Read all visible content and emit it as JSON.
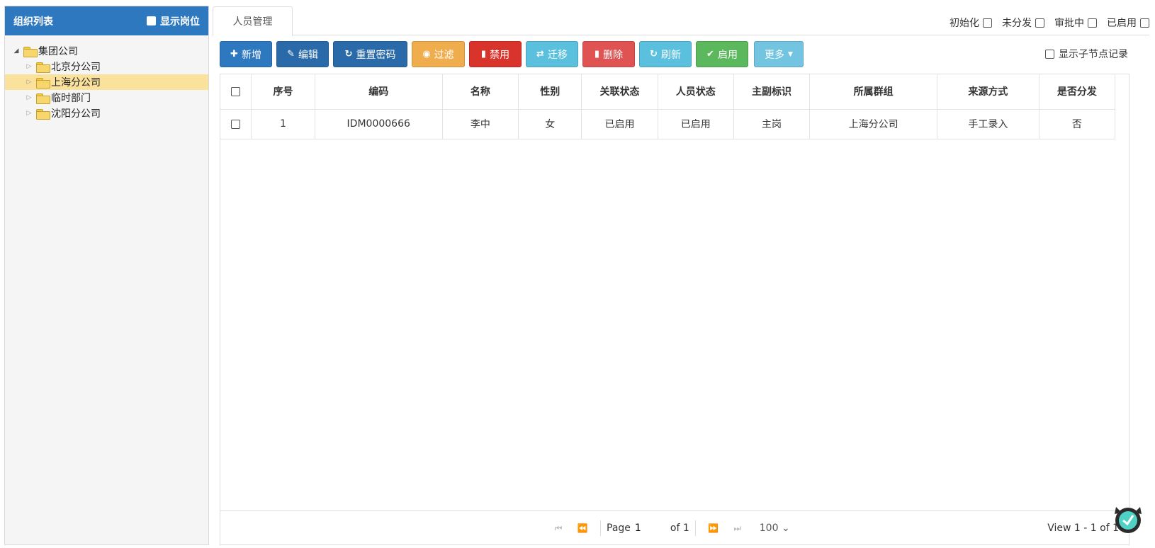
{
  "left": {
    "title": "组织列表",
    "show_post_label": "显示岗位",
    "tree": [
      {
        "label": "集团公司",
        "level": 0,
        "expanded": true,
        "selected": false
      },
      {
        "label": "北京分公司",
        "level": 1,
        "expanded": false,
        "selected": false
      },
      {
        "label": "上海分公司",
        "level": 1,
        "expanded": false,
        "selected": true
      },
      {
        "label": "临时部门",
        "level": 1,
        "expanded": false,
        "selected": false
      },
      {
        "label": "沈阳分公司",
        "level": 1,
        "expanded": false,
        "selected": false
      }
    ]
  },
  "tab": {
    "label": "人员管理"
  },
  "status_filters": [
    "初始化",
    "未分发",
    "审批中",
    "已启用"
  ],
  "toolbar": {
    "add": "新增",
    "edit": "编辑",
    "reset_password": "重置密码",
    "filter": "过滤",
    "disable": "禁用",
    "migrate": "迁移",
    "delete": "删除",
    "refresh": "刷新",
    "enable": "启用",
    "more": "更多"
  },
  "show_child_label": "显示子节点记录",
  "grid": {
    "columns": [
      "序号",
      "编码",
      "名称",
      "性别",
      "关联状态",
      "人员状态",
      "主副标识",
      "所属群组",
      "来源方式",
      "是否分发"
    ],
    "rows": [
      [
        "1",
        "IDM0000666",
        "李中",
        "女",
        "已启用",
        "已启用",
        "主岗",
        "上海分公司",
        "手工录入",
        "否"
      ]
    ]
  },
  "pager": {
    "page_label": "Page",
    "page_value": "1",
    "of_label": "of 1",
    "page_size": "100",
    "view_text": "View 1 - 1 of 1"
  },
  "colors": {
    "header_blue": "#2e78bf",
    "selected_row": "#fbe29c"
  }
}
